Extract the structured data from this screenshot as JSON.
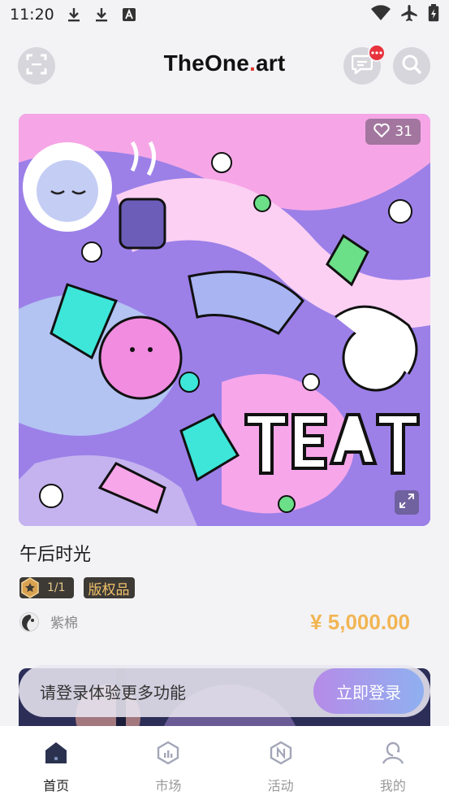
{
  "status_bar": {
    "time": "11:20",
    "left_icons": [
      "download-icon",
      "download-icon",
      "font-icon"
    ],
    "right_icons": [
      "wifi-icon",
      "airplane-icon",
      "battery-icon"
    ]
  },
  "header": {
    "logo_text": "TheOne",
    "logo_dot": ".",
    "logo_suffix": "art",
    "scan_icon": "scan-icon",
    "message_icon": "message-icon",
    "search_icon": "search-icon"
  },
  "artwork": {
    "likes": "31",
    "title": "午后时光",
    "edition": "1/1",
    "copyright_label": "版权品",
    "creator_name": "紫棉",
    "price": "¥ 5,000.00"
  },
  "login_prompt": {
    "text": "请登录体验更多功能",
    "button": "立即登录"
  },
  "bottom_nav": [
    {
      "label": "首页",
      "icon": "home-icon",
      "active": true
    },
    {
      "label": "市场",
      "icon": "market-icon",
      "active": false
    },
    {
      "label": "活动",
      "icon": "activity-icon",
      "active": false
    },
    {
      "label": "我的",
      "icon": "profile-icon",
      "active": false
    }
  ],
  "colors": {
    "accent_price": "#f2b553",
    "badge_red": "#e8323c",
    "login_gradient_start": "#b68be8",
    "login_gradient_end": "#8fb0f0"
  }
}
